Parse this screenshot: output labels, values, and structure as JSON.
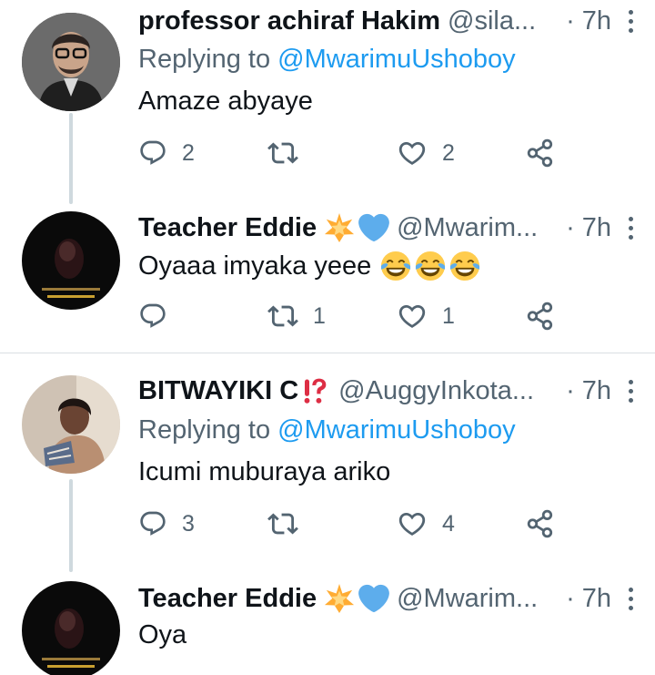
{
  "tweets": [
    {
      "name": "professor achiraf Hakim",
      "badges": [],
      "handle": "@sila...",
      "dot": "·",
      "time": "7h",
      "replying_label": "Replying to",
      "replying_handle": "@MwarimuUshoboy",
      "text": "Amaze abyaye",
      "text_emoji": [],
      "replies": "2",
      "retweets": "",
      "likes": "2"
    },
    {
      "name": "Teacher Eddie",
      "badges": [
        "glowing-star-icon",
        "blue-heart-icon"
      ],
      "handle": "@Mwarim...",
      "dot": "·",
      "time": "7h",
      "replying_label": "",
      "replying_handle": "",
      "text": "Oyaaa imyaka yeee",
      "text_emoji": [
        "tears-of-joy-icon",
        "tears-of-joy-icon",
        "tears-of-joy-icon"
      ],
      "replies": "",
      "retweets": "1",
      "likes": "1"
    },
    {
      "name": "BITWAYIKI C",
      "badges": [
        "exclamation-question-icon"
      ],
      "handle": "@AuggyInkota...",
      "dot": "·",
      "time": "7h",
      "replying_label": "Replying to",
      "replying_handle": "@MwarimuUshoboy",
      "text": "Icumi muburaya ariko",
      "text_emoji": [],
      "replies": "3",
      "retweets": "",
      "likes": "4"
    },
    {
      "name": "Teacher Eddie",
      "badges": [
        "glowing-star-icon",
        "blue-heart-icon"
      ],
      "handle": "@Mwarim...",
      "dot": "·",
      "time": "7h",
      "replying_label": "",
      "replying_handle": "",
      "text": "Oya",
      "text_emoji": []
    }
  ],
  "colors": {
    "text_primary": "#0f1419",
    "text_secondary": "#536471",
    "link": "#1d9bf0",
    "thread_line": "#cfd9de",
    "divider": "#dadfe3",
    "star": "#ffac33",
    "heart_blue": "#5dadec",
    "tears_face": "#ffcc4d"
  }
}
